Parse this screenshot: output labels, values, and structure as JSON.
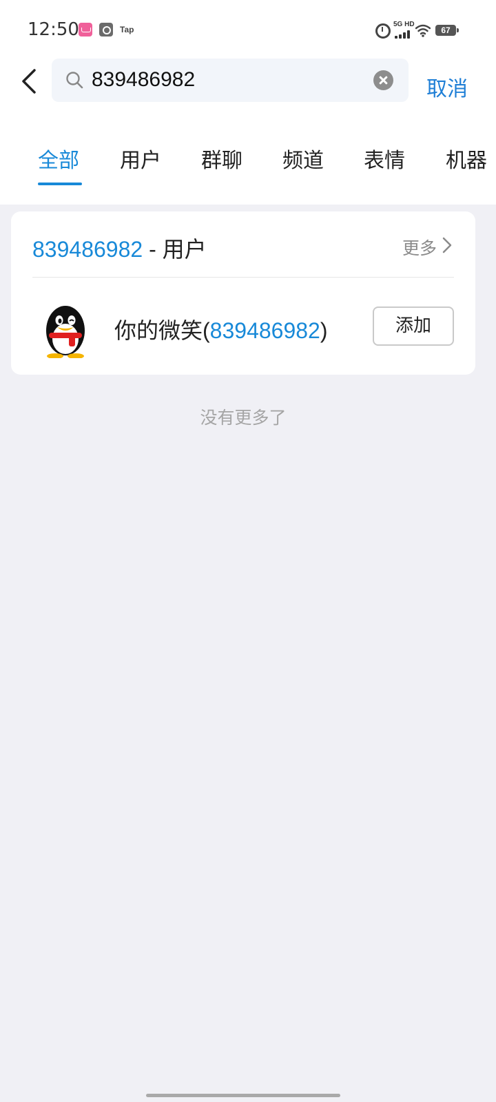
{
  "status_bar": {
    "time": "12:50",
    "app_icons": [
      "red-app-icon",
      "gray-app-icon"
    ],
    "tap_label": "Tap",
    "network_label": "5G HD",
    "battery": "67"
  },
  "search": {
    "query": "839486982",
    "cancel_label": "取消"
  },
  "tabs": [
    {
      "label": "全部",
      "active": true
    },
    {
      "label": "用户",
      "active": false
    },
    {
      "label": "群聊",
      "active": false
    },
    {
      "label": "频道",
      "active": false
    },
    {
      "label": "表情",
      "active": false
    },
    {
      "label": "机器",
      "active": false
    }
  ],
  "result_section": {
    "query_highlight": "839486982",
    "category_suffix": " - 用户",
    "more_label": "更多",
    "users": [
      {
        "name_prefix": "你的微笑(",
        "id_highlight": "839486982",
        "name_suffix": ")",
        "add_label": "添加",
        "avatar": "penguin-avatar"
      }
    ]
  },
  "footer_text": "没有更多了",
  "colors": {
    "accent": "#1889d8",
    "background": "#f0f0f5",
    "card": "#ffffff"
  }
}
